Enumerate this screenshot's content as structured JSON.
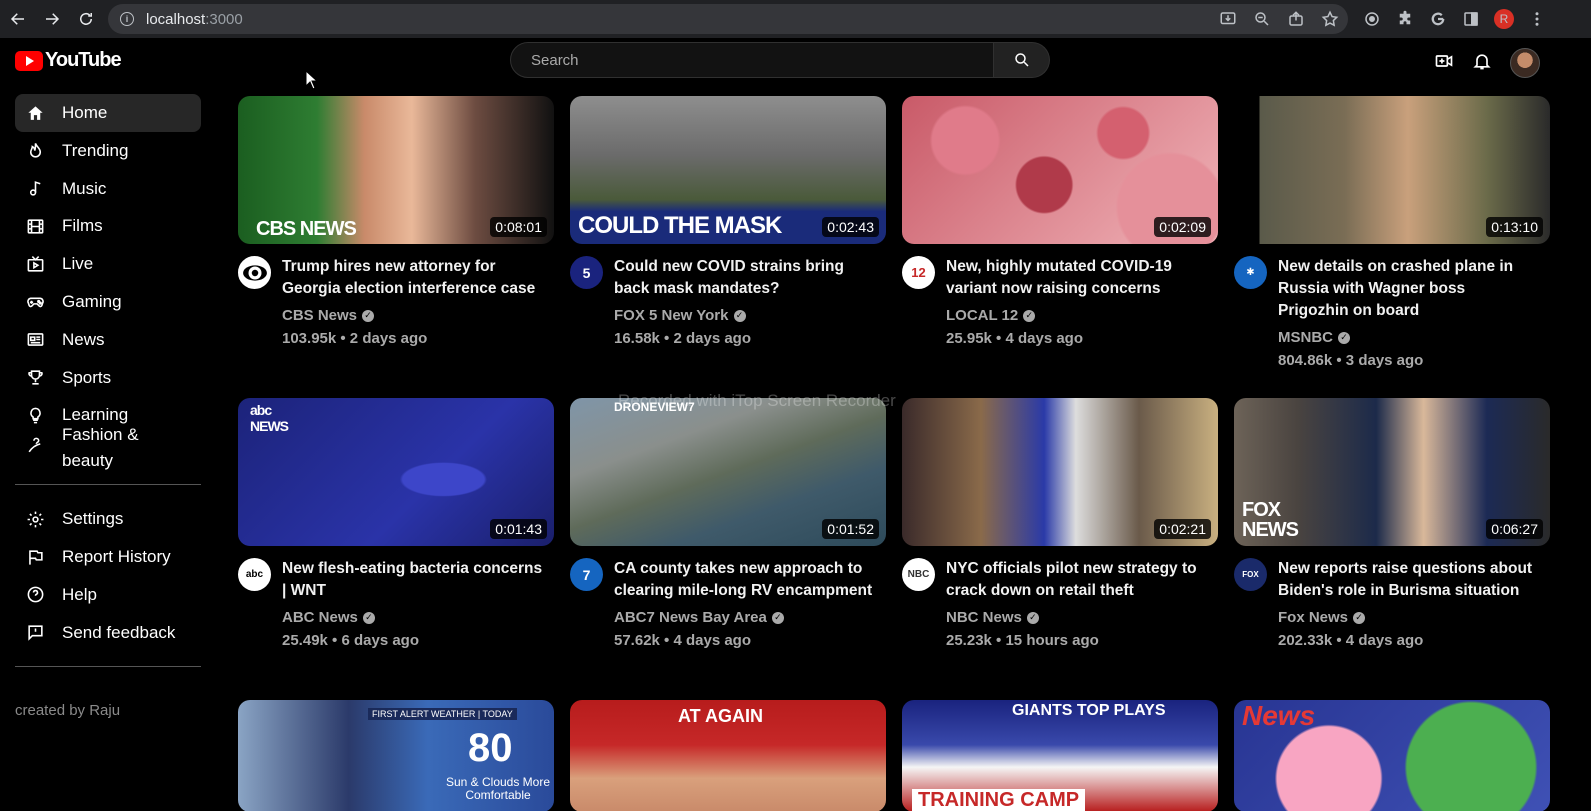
{
  "browser": {
    "url_host": "localhost",
    "url_port": ":3000",
    "profile_letter": "R"
  },
  "header": {
    "logo_text": "YouTube",
    "search_placeholder": "Search"
  },
  "sidebar": {
    "items": [
      {
        "label": "Home",
        "icon": "home-icon"
      },
      {
        "label": "Trending",
        "icon": "fire-icon"
      },
      {
        "label": "Music",
        "icon": "music-icon"
      },
      {
        "label": "Films",
        "icon": "film-icon"
      },
      {
        "label": "Live",
        "icon": "live-icon"
      },
      {
        "label": "Gaming",
        "icon": "gamepad-icon"
      },
      {
        "label": "News",
        "icon": "news-icon"
      },
      {
        "label": "Sports",
        "icon": "trophy-icon"
      },
      {
        "label": "Learning",
        "icon": "lightbulb-icon"
      },
      {
        "label": "Fashion &\nbeauty",
        "icon": "hanger-icon"
      }
    ],
    "secondary": [
      {
        "label": "Settings",
        "icon": "gear-icon"
      },
      {
        "label": "Report History",
        "icon": "flag-icon"
      },
      {
        "label": "Help",
        "icon": "help-icon"
      },
      {
        "label": "Send feedback",
        "icon": "feedback-icon"
      }
    ],
    "footer": "created by Raju"
  },
  "videos": [
    {
      "title": "Trump hires new attorney for Georgia election interference case",
      "channel": "CBS News",
      "stats": "103.95k • 2 days ago",
      "duration": "0:08:01",
      "thumb_brand": "CBS NEWS"
    },
    {
      "title": "Could new COVID strains bring back mask mandates?",
      "channel": "FOX 5 New York",
      "stats": "16.58k • 2 days ago",
      "duration": "0:02:43",
      "thumb_brand": "COULD THE MASK"
    },
    {
      "title": "New, highly mutated COVID-19 variant now raising concerns",
      "channel": "LOCAL 12",
      "stats": "25.95k • 4 days ago",
      "duration": "0:02:09",
      "thumb_brand": ""
    },
    {
      "title": "New details on crashed plane in Russia with Wagner boss Prigozhin on board",
      "channel": "MSNBC",
      "stats": "804.86k • 3 days ago",
      "duration": "0:13:10",
      "thumb_brand": ""
    },
    {
      "title": "New flesh-eating bacteria concerns | WNT",
      "channel": "ABC News",
      "stats": "25.49k • 6 days ago",
      "duration": "0:01:43",
      "thumb_brand": "abc NEWS"
    },
    {
      "title": "CA county takes new approach to clearing mile-long RV encampment",
      "channel": "ABC7 News Bay Area",
      "stats": "57.62k • 4 days ago",
      "duration": "0:01:52",
      "thumb_brand": "DRONEVIEW7"
    },
    {
      "title": "NYC officials pilot new strategy to crack down on retail theft",
      "channel": "NBC News",
      "stats": "25.23k • 15 hours ago",
      "duration": "0:02:21",
      "thumb_brand": ""
    },
    {
      "title": "New reports raise questions about Biden's role in Burisma situation",
      "channel": "Fox News",
      "stats": "202.33k • 4 days ago",
      "duration": "0:06:27",
      "thumb_brand": "FOX NEWS"
    }
  ],
  "partial_thumbs": [
    {
      "text_a": "FIRST ALERT WEATHER | TODAY",
      "text_b": "80",
      "text_c": "Sun & Clouds More Comfortable"
    },
    {
      "text_a": "AT AGAIN"
    },
    {
      "text_a": "TRAINING CAMP",
      "text_b": "GIANTS TOP PLAYS"
    },
    {
      "text_a": "News"
    }
  ],
  "watermark": "Recorded with iTop Screen Recorder"
}
